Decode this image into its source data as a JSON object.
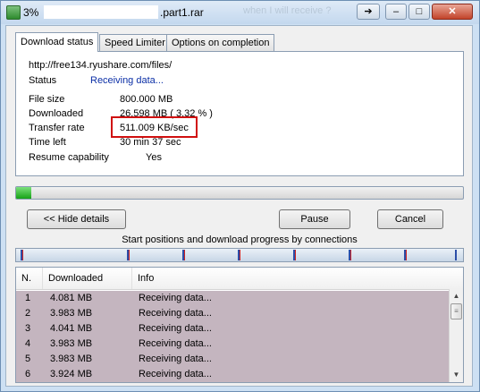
{
  "window": {
    "title_prefix": "3%",
    "title_suffix": ".part1.rar",
    "ghost_text": "when I will receive ?",
    "buttons": {
      "arrow": "➔",
      "minimize": "–",
      "maximize": "□",
      "close": "✕"
    }
  },
  "tabs": [
    {
      "label": "Download status"
    },
    {
      "label": "Speed Limiter"
    },
    {
      "label": "Options on completion"
    }
  ],
  "status": {
    "url": "http://free134.ryushare.com/files/",
    "status_label": "Status",
    "status_value": "Receiving data...",
    "file_size_label": "File size",
    "file_size_value": "800.000  MB",
    "downloaded_label": "Downloaded",
    "downloaded_value": "26.598  MB  ( 3.32 % )",
    "rate_label": "Transfer rate",
    "rate_value": "511.009  KB/sec",
    "time_left_label": "Time left",
    "time_left_value": "30 min 37 sec",
    "resume_label": "Resume capability",
    "resume_value": "Yes"
  },
  "progress": {
    "fraction": 0.0332
  },
  "buttons": {
    "hide_details": "<< Hide details",
    "pause": "Pause",
    "cancel": "Cancel"
  },
  "connections": {
    "caption": "Start positions and download progress by connections",
    "markers": [
      0.01,
      0.25,
      0.375,
      0.5,
      0.625,
      0.75,
      0.875,
      0.99
    ]
  },
  "list": {
    "columns": [
      "N.",
      "Downloaded",
      "Info"
    ],
    "rows": [
      {
        "n": "1",
        "downloaded": "4.081  MB",
        "info": "Receiving data..."
      },
      {
        "n": "2",
        "downloaded": "3.983  MB",
        "info": "Receiving data..."
      },
      {
        "n": "3",
        "downloaded": "4.041  MB",
        "info": "Receiving data..."
      },
      {
        "n": "4",
        "downloaded": "3.983  MB",
        "info": "Receiving data..."
      },
      {
        "n": "5",
        "downloaded": "3.983  MB",
        "info": "Receiving data..."
      },
      {
        "n": "6",
        "downloaded": "3.924  MB",
        "info": "Receiving data..."
      }
    ]
  },
  "colors": {
    "progress": "#16a316",
    "highlight": "#d01010",
    "row_bg": "#c4b5bf",
    "status_blue": "#0b2fa6"
  }
}
